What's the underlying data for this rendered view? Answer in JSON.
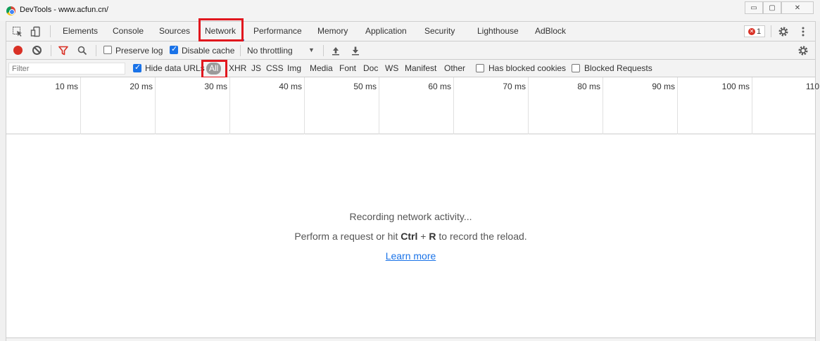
{
  "window": {
    "title": "DevTools - www.acfun.cn/",
    "min_glyph": "▭",
    "max_glyph": "▢",
    "close_glyph": "✕"
  },
  "tabs": [
    {
      "label": "Elements"
    },
    {
      "label": "Console"
    },
    {
      "label": "Sources"
    },
    {
      "label": "Network",
      "selected": true
    },
    {
      "label": "Performance"
    },
    {
      "label": "Memory"
    },
    {
      "label": "Application"
    },
    {
      "label": "Security"
    },
    {
      "label": "Lighthouse"
    },
    {
      "label": "AdBlock"
    }
  ],
  "error_badge": {
    "count": "1",
    "glyph": "✕"
  },
  "toolbar": {
    "preserve_log": "Preserve log",
    "preserve_log_checked": false,
    "disable_cache": "Disable cache",
    "disable_cache_checked": true,
    "throttling": "No throttling",
    "throttling_arrow": "▼"
  },
  "filter": {
    "placeholder": "Filter",
    "hide_data_urls": "Hide data URLs",
    "hide_data_urls_checked": true,
    "types": [
      "All",
      "XHR",
      "JS",
      "CSS",
      "Img",
      "Media",
      "Font",
      "Doc",
      "WS",
      "Manifest",
      "Other"
    ],
    "active_type": "All",
    "has_blocked_cookies": "Has blocked cookies",
    "blocked_requests": "Blocked Requests"
  },
  "timeline_ticks": [
    "10 ms",
    "20 ms",
    "30 ms",
    "40 ms",
    "50 ms",
    "60 ms",
    "70 ms",
    "80 ms",
    "90 ms",
    "100 ms",
    "110"
  ],
  "empty_state": {
    "line1": "Recording network activity...",
    "line2_before": "Perform a request or hit ",
    "line2_ctrl": "Ctrl",
    "line2_plus": " + ",
    "line2_key": "R",
    "line2_after": " to record the reload.",
    "learn_more": "Learn more"
  },
  "colors": {
    "record": "#d93025",
    "accent": "#1a73e8",
    "highlight_box": "#e1171e"
  }
}
